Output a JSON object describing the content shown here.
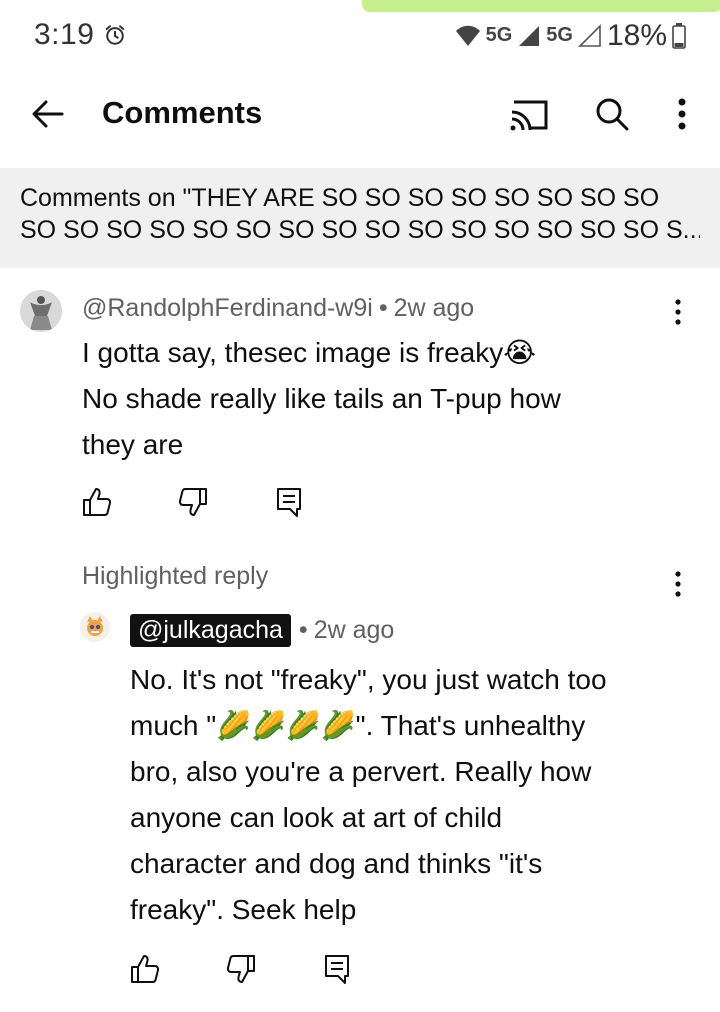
{
  "status_bar": {
    "time": "3:19",
    "network1": "5G",
    "network2": "5G",
    "battery": "18%",
    "accent": "#c5ef8f"
  },
  "app_bar": {
    "title": "Comments",
    "icons": [
      "back-arrow-icon",
      "cast-icon",
      "search-icon",
      "more-vert-icon"
    ]
  },
  "context": {
    "line1": "Comments on \"THEY ARE SO SO SO SO SO SO SO SO",
    "line2": "SO SO SO SO SO SO SO SO SO SO SO SO SO SO SO S..."
  },
  "comment": {
    "handle": "@RandolphFerdinand-w9i",
    "age": "2w ago",
    "line1": "I gotta say, thesec image is freaky",
    "line1_emoji": "😭",
    "line2": "No shade really like tails an T-pup how",
    "line3": "they are"
  },
  "reply": {
    "section_label": "Highlighted reply",
    "handle": "@julkagacha",
    "age": "2w ago",
    "line1": "No. It's not \"freaky\", you just watch too",
    "line2_pre": "much \"",
    "line2_emoji": "🌽🌽🌽🌽",
    "line2_post": "\". That's unhealthy",
    "line3": "bro, also you're a pervert. Really how",
    "line4": "anyone can look at art of child",
    "line5": "character and dog and thinks \"it's",
    "line6": "freaky\". Seek help"
  },
  "separator": "•"
}
